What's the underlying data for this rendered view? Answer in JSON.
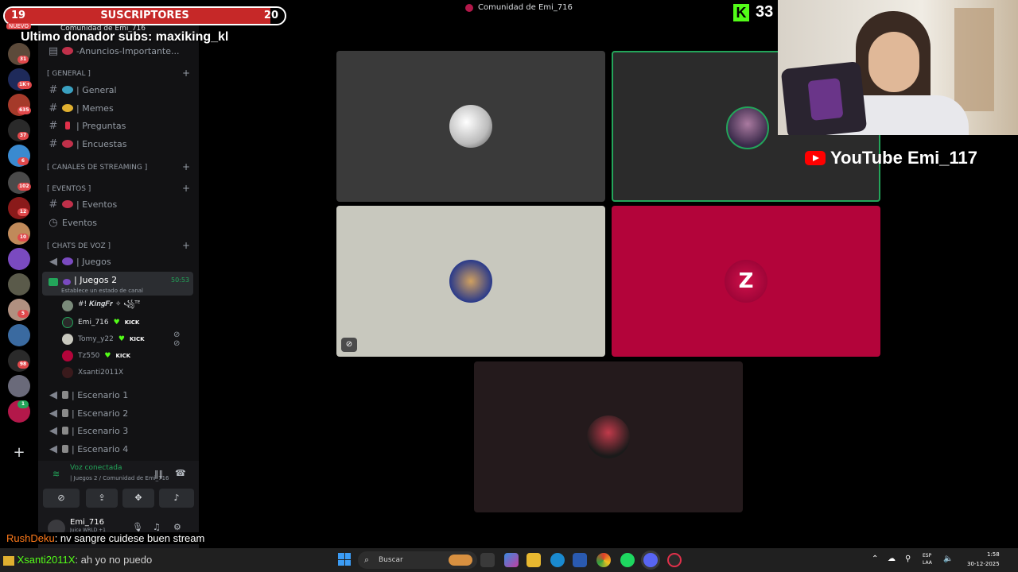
{
  "overlay": {
    "subs_current": "19",
    "subs_label": "SUSCRIPTORES",
    "subs_goal": "20",
    "subs_progress_fraction": 0.95,
    "donor_text": "Ultimo donador subs: maxiking_kl",
    "kick_viewers": "33",
    "youtube_text": "YouTube Emi_117",
    "new_badge": "NUEVO"
  },
  "top": {
    "server_title": "Comunidad de Emi_716",
    "sidebar_server": "Comunidad de Emi_716"
  },
  "rail": {
    "badges": [
      "31",
      "1K+",
      "635",
      "37",
      "6",
      "102",
      "12",
      "10",
      "5",
      "98",
      "1"
    ]
  },
  "sidebar": {
    "announcements": "-Anuncios-Importante...",
    "cat_general": "[ GENERAL ]",
    "general_channels": [
      "| General",
      "| Memes",
      "| Preguntas",
      "| Encuestas"
    ],
    "cat_streaming": "[ CANALES DE STREAMING ]",
    "cat_events": "[ EVENTOS ]",
    "event_channel": "| Eventos",
    "events_link": "Eventos",
    "cat_voice": "[ CHATS DE VOZ ]",
    "voice_juegos": "| Juegos",
    "active_channel": "| Juegos 2",
    "active_status": "Establece un estado de canal",
    "active_time": "50:53",
    "voice_users": [
      {
        "name": "#! 𝑲𝒊𝒏𝒈𝑭𝒓 ✧ ꧁ᵀᴱ ",
        "kick": false
      },
      {
        "name": "Emi_716",
        "kick": true
      },
      {
        "name": "Tomy_y22",
        "kick": true
      },
      {
        "name": "Tz550",
        "kick": true
      },
      {
        "name": "Xsanti2011X",
        "kick": false
      }
    ],
    "kick_label": "KICK",
    "stages": [
      "| Escenario 1",
      "| Escenario 2",
      "| Escenario 3",
      "| Escenario 4"
    ]
  },
  "panel": {
    "voice_connected": "Voz conectada",
    "voice_sub": "| Juegos 2 / Comunidad de Emi_716",
    "user_name": "Emi_716",
    "user_status": "Juice WRLD +1"
  },
  "chat": [
    {
      "user": "RushDeku",
      "text": ": nv sangre cuidese buen stream",
      "color": "#ff7a1a"
    },
    {
      "user": "Xsanti2011X",
      "text": ": ah yo no puedo",
      "color": "#53fc18"
    }
  ],
  "taskbar": {
    "search_placeholder": "Buscar",
    "lang_top": "ESP",
    "lang_bottom": "LAA",
    "time": "1:58",
    "date": "30-12-2025"
  },
  "colors": {
    "accent_green": "#23a55a",
    "tile_gray": "#3a3a3a",
    "tile_light": "#c8c8be",
    "tile_red": "#b3043a",
    "tile_dark": "#241a1c",
    "kick_green": "#53fc18"
  }
}
